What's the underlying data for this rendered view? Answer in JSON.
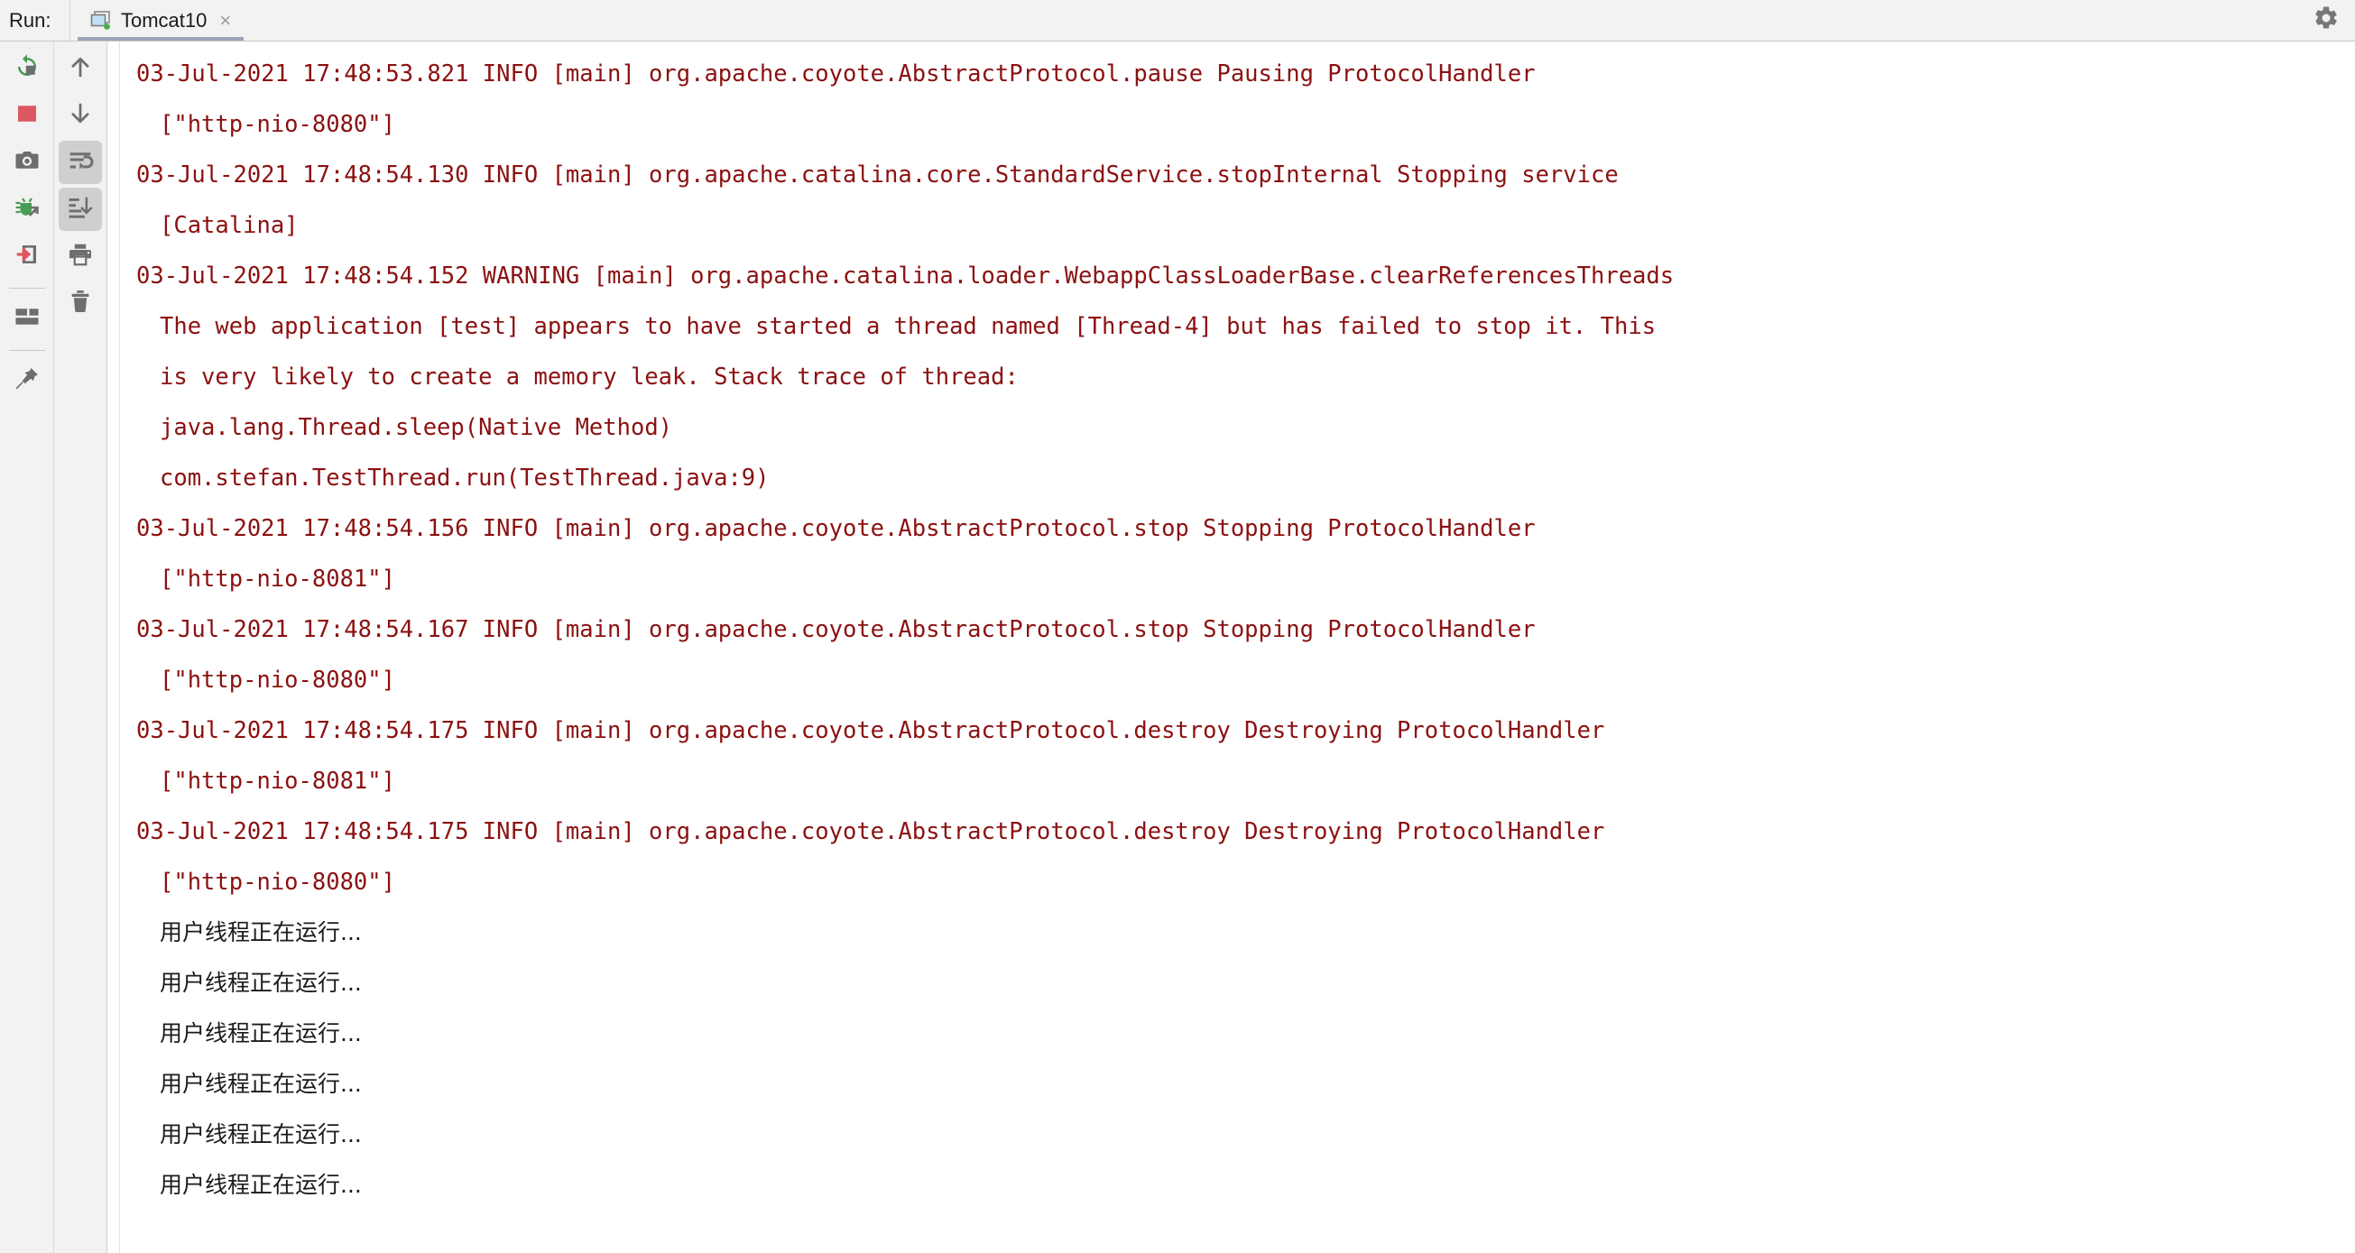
{
  "window": {
    "run_label": "Run:",
    "gear_icon": "gear-icon"
  },
  "tabs": [
    {
      "label": "Tomcat10",
      "icon": "tomcat-server-icon",
      "close": "×",
      "active": true
    }
  ],
  "toolbar_left": {
    "column_one": [
      {
        "name": "rerun-button",
        "icon": "rerun-icon",
        "label": "Rerun"
      },
      {
        "name": "stop-button",
        "icon": "stop-square-icon",
        "label": "Stop"
      },
      {
        "name": "screenshot-button",
        "icon": "camera-icon",
        "label": "Screenshot"
      },
      {
        "name": "debug-button",
        "icon": "debug-bug-icon",
        "label": "Debug"
      },
      {
        "name": "import-button",
        "icon": "arrow-into-box-icon",
        "label": "Import"
      },
      {
        "name": "separator-1",
        "icon": "separator",
        "label": ""
      },
      {
        "name": "layout-button",
        "icon": "layout-panels-icon",
        "label": "Layout"
      },
      {
        "name": "separator-2",
        "icon": "separator",
        "label": ""
      },
      {
        "name": "pin-tab-button",
        "icon": "pin-icon",
        "label": "Pin Tab"
      }
    ],
    "column_two": [
      {
        "name": "up-button",
        "icon": "arrow-up-icon",
        "label": "Up the Stack Trace",
        "pressed": false
      },
      {
        "name": "down-button",
        "icon": "arrow-down-icon",
        "label": "Down the Stack Trace",
        "pressed": false
      },
      {
        "name": "soft-wrap-button",
        "icon": "soft-wrap-icon",
        "label": "Use Soft Wraps",
        "pressed": true
      },
      {
        "name": "scroll-to-end-button",
        "icon": "scroll-to-end-icon",
        "label": "Scroll to the End",
        "pressed": true
      },
      {
        "name": "print-button",
        "icon": "printer-icon",
        "label": "Print",
        "pressed": false
      },
      {
        "name": "clear-all-button",
        "icon": "trash-icon",
        "label": "Clear All",
        "pressed": false
      }
    ]
  },
  "console": {
    "lines": [
      {
        "text": "03-Jul-2021 17:48:53.821 INFO [main] org.apache.coyote.AbstractProtocol.pause Pausing ProtocolHandler",
        "kind": "log",
        "cont": false
      },
      {
        "text": "[\"http-nio-8080\"]",
        "kind": "log",
        "cont": true
      },
      {
        "text": "03-Jul-2021 17:48:54.130 INFO [main] org.apache.catalina.core.StandardService.stopInternal Stopping service",
        "kind": "log",
        "cont": false
      },
      {
        "text": "[Catalina]",
        "kind": "log",
        "cont": true
      },
      {
        "text": "03-Jul-2021 17:48:54.152 WARNING [main] org.apache.catalina.loader.WebappClassLoaderBase.clearReferencesThreads",
        "kind": "log",
        "cont": false
      },
      {
        "text": "The web application [test] appears to have started a thread named [Thread-4] but has failed to stop it. This",
        "kind": "log",
        "cont": true
      },
      {
        "text": "is very likely to create a memory leak. Stack trace of thread:",
        "kind": "log",
        "cont": true
      },
      {
        "text": "java.lang.Thread.sleep(Native Method)",
        "kind": "log",
        "cont": true
      },
      {
        "text": "com.stefan.TestThread.run(TestThread.java:9)",
        "kind": "log",
        "cont": true
      },
      {
        "text": "03-Jul-2021 17:48:54.156 INFO [main] org.apache.coyote.AbstractProtocol.stop Stopping ProtocolHandler",
        "kind": "log",
        "cont": false
      },
      {
        "text": "[\"http-nio-8081\"]",
        "kind": "log",
        "cont": true
      },
      {
        "text": "03-Jul-2021 17:48:54.167 INFO [main] org.apache.coyote.AbstractProtocol.stop Stopping ProtocolHandler",
        "kind": "log",
        "cont": false
      },
      {
        "text": "[\"http-nio-8080\"]",
        "kind": "log",
        "cont": true
      },
      {
        "text": "03-Jul-2021 17:48:54.175 INFO [main] org.apache.coyote.AbstractProtocol.destroy Destroying ProtocolHandler",
        "kind": "log",
        "cont": false
      },
      {
        "text": "[\"http-nio-8081\"]",
        "kind": "log",
        "cont": true
      },
      {
        "text": "03-Jul-2021 17:48:54.175 INFO [main] org.apache.coyote.AbstractProtocol.destroy Destroying ProtocolHandler",
        "kind": "log",
        "cont": false
      },
      {
        "text": "[\"http-nio-8080\"]",
        "kind": "log",
        "cont": true
      },
      {
        "text": "用户线程正在运行...",
        "kind": "cn",
        "cont": true
      },
      {
        "text": "用户线程正在运行...",
        "kind": "cn",
        "cont": true
      },
      {
        "text": "用户线程正在运行...",
        "kind": "cn",
        "cont": true
      },
      {
        "text": "用户线程正在运行...",
        "kind": "cn",
        "cont": true
      },
      {
        "text": "用户线程正在运行...",
        "kind": "cn",
        "cont": true
      },
      {
        "text": "用户线程正在运行...",
        "kind": "cn",
        "cont": true
      }
    ]
  },
  "colors": {
    "log_text": "#8b1111",
    "plain_text": "#1b1b1b",
    "chrome_bg": "#f2f2f2",
    "console_bg": "#ffffff",
    "tab_underline": "#9aa7b7",
    "accent_green": "#499c54",
    "accent_red": "#db5860"
  }
}
